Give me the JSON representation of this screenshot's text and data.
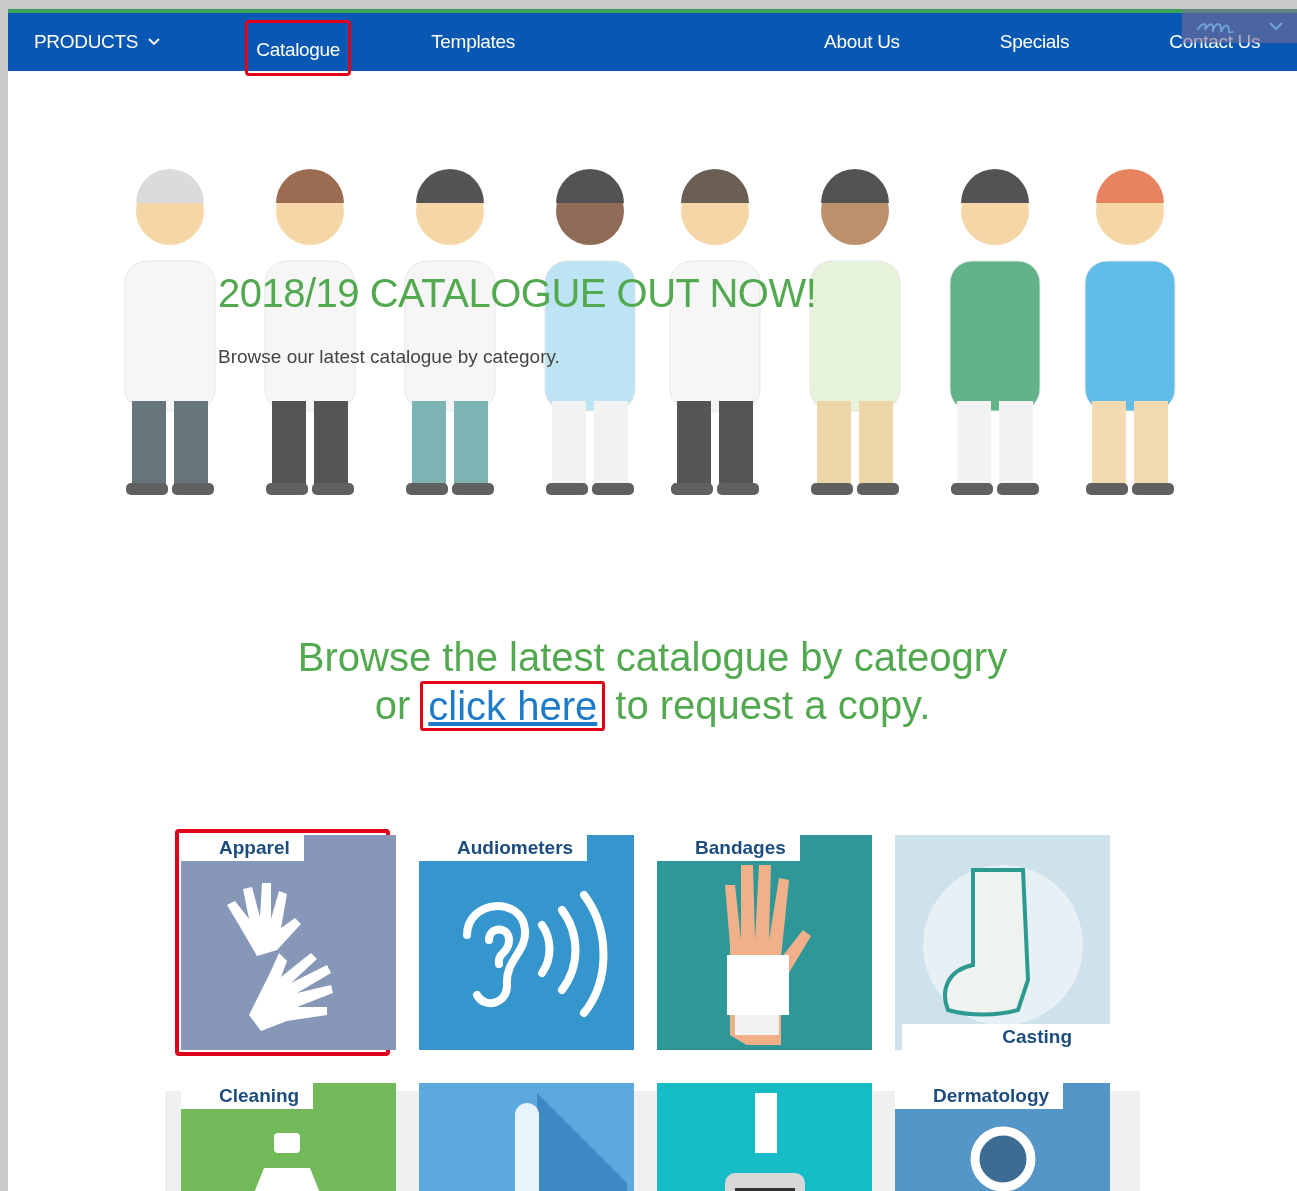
{
  "nav": {
    "items": [
      {
        "label": "PRODUCTS",
        "kind": "dropdown",
        "highlighted": false
      },
      {
        "label": "Catalogue",
        "kind": "link",
        "highlighted": true
      },
      {
        "label": "Templates",
        "kind": "link",
        "highlighted": false
      },
      {
        "label": "About Us",
        "kind": "link",
        "highlighted": false
      },
      {
        "label": "Specials",
        "kind": "link",
        "highlighted": false
      },
      {
        "label": "Contact Us",
        "kind": "link",
        "highlighted": false
      }
    ]
  },
  "hero": {
    "headline": "2018/19 CATALOGUE OUT NOW!",
    "subtitle": "Browse our latest catalogue by category."
  },
  "intro": {
    "line_1": "Browse the latest catalogue by cateogry",
    "before_link": "or",
    "link": {
      "label": "click here",
      "highlighted": true
    },
    "after_link": "to request a copy."
  },
  "tiles": [
    {
      "label": "Apparel",
      "kind": "gloves",
      "label_at_bottom": false,
      "color": "#8797b8",
      "highlighted": true
    },
    {
      "label": "Audiometers",
      "kind": "ear",
      "label_at_bottom": false,
      "color": "#3595cd",
      "highlighted": false
    },
    {
      "label": "Bandages",
      "kind": "hand",
      "label_at_bottom": false,
      "color": "#2e9898",
      "highlighted": false
    },
    {
      "label": "Casting",
      "kind": "cast",
      "label_at_bottom": true,
      "color": "#cfe1ea",
      "highlighted": false
    },
    {
      "label": "Cleaning",
      "kind": "bottle",
      "label_at_bottom": false,
      "color": "#72b95a",
      "highlighted": false
    },
    {
      "kind": "thermometer",
      "color": "#5da8dc",
      "highlighted": false
    },
    {
      "kind": "monitor",
      "color": "#16bcc6",
      "highlighted": false
    },
    {
      "label": "Dermatology",
      "kind": "magnifier",
      "label_at_bottom": false,
      "color": "#5496c7",
      "highlighted": false
    }
  ]
}
